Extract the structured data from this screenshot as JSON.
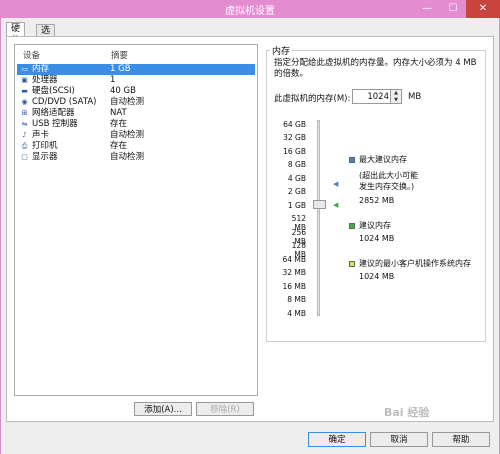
{
  "window": {
    "title": "虚拟机设置",
    "minimize": "—",
    "maximize": "☐",
    "close": "✕"
  },
  "tabs": [
    {
      "label": "硬件"
    },
    {
      "label": "选项"
    }
  ],
  "device_list": {
    "columns": [
      "设备",
      "摘要"
    ],
    "rows": [
      {
        "icon": "memory-icon",
        "glyph": "▭",
        "name": "内存",
        "summary": "1 GB",
        "selected": true
      },
      {
        "icon": "processor-icon",
        "glyph": "▣",
        "name": "处理器",
        "summary": "1"
      },
      {
        "icon": "harddisk-icon",
        "glyph": "▬",
        "name": "硬盘(SCSI)",
        "summary": "40 GB"
      },
      {
        "icon": "cd-dvd-icon",
        "glyph": "◉",
        "name": "CD/DVD (SATA)",
        "summary": "自动检测"
      },
      {
        "icon": "network-adapter-icon",
        "glyph": "⊞",
        "name": "网络适配器",
        "summary": "NAT"
      },
      {
        "icon": "usb-controller-icon",
        "glyph": "⇋",
        "name": "USB 控制器",
        "summary": "存在"
      },
      {
        "icon": "sound-card-icon",
        "glyph": "♪",
        "name": "声卡",
        "summary": "自动检测"
      },
      {
        "icon": "printer-icon",
        "glyph": "⎙",
        "name": "打印机",
        "summary": "存在"
      },
      {
        "icon": "display-icon",
        "glyph": "▢",
        "name": "显示器",
        "summary": "自动检测"
      }
    ],
    "add_button": "添加(A)...",
    "remove_button": "移除(R)"
  },
  "memory": {
    "group_title": "内存",
    "description": "指定分配给此虚拟机的内存量。内存大小必须为 4 MB 的倍数。",
    "label": "此虚拟机的内存(M):",
    "value": "1024",
    "unit": "MB",
    "scale": [
      "64 GB",
      "32 GB",
      "16 GB",
      "8 GB",
      "4 GB",
      "2 GB",
      "1 GB",
      "512 MB",
      "256 MB",
      "128 MB",
      "64 MB",
      "32 MB",
      "16 MB",
      "8 MB",
      "4 MB"
    ],
    "legend": {
      "max_recommended": {
        "title": "最大建议内存",
        "note1": "(超出此大小可能",
        "note2": "发生内存交换。)",
        "value": "2852 MB",
        "color": "#4a7fc8"
      },
      "recommended": {
        "title": "建议内存",
        "value": "1024 MB",
        "color": "#3fae3f"
      },
      "min_guest": {
        "title": "建议的最小客户机操作系统内存",
        "value": "1024 MB",
        "color": "#e8d84a"
      }
    }
  },
  "buttons": {
    "ok": "确定",
    "cancel": "取消",
    "help": "帮助"
  },
  "watermark": "Bai 经验"
}
